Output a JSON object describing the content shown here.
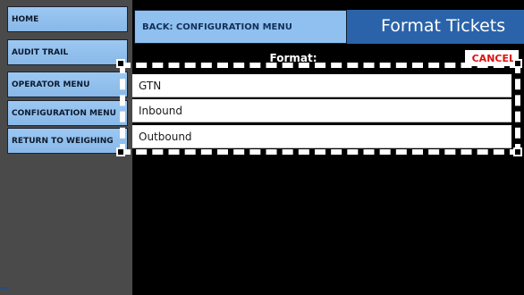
{
  "sidebar": {
    "items": [
      {
        "label": "HOME"
      },
      {
        "label": "AUDIT TRAIL"
      },
      {
        "label": "OPERATOR MENU"
      },
      {
        "label": "CONFIGURATION MENU"
      },
      {
        "label": "RETURN TO WEIGHING"
      }
    ]
  },
  "header": {
    "back_label": "BACK: CONFIGURATION MENU",
    "title": "Format Tickets"
  },
  "format": {
    "label": "Format:",
    "cancel_label": "CANCEL",
    "options": [
      {
        "label": "GTN"
      },
      {
        "label": "Inbound"
      },
      {
        "label": "Outbound"
      }
    ]
  },
  "colors": {
    "sidebar_button": "#9cc8f2",
    "title_bar": "#2a63a9",
    "cancel_text": "#e01010",
    "background": "#000000",
    "sidebar_bg": "#4a4a4a"
  }
}
